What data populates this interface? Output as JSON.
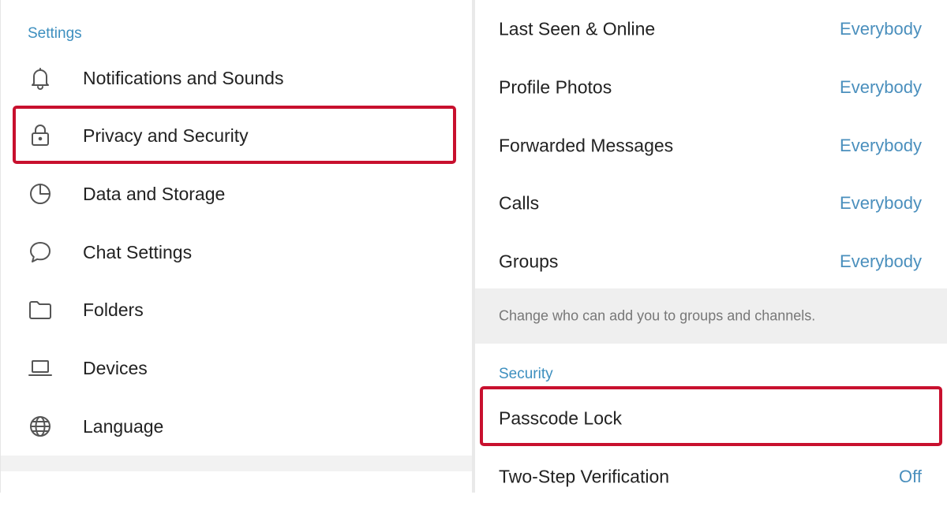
{
  "left_panel": {
    "header": "Settings",
    "items": [
      {
        "label": "Notifications and Sounds",
        "icon": "bell-icon"
      },
      {
        "label": "Privacy and Security",
        "icon": "lock-icon"
      },
      {
        "label": "Data and Storage",
        "icon": "pie-chart-icon"
      },
      {
        "label": "Chat Settings",
        "icon": "chat-bubble-icon"
      },
      {
        "label": "Folders",
        "icon": "folder-icon"
      },
      {
        "label": "Devices",
        "icon": "laptop-icon"
      },
      {
        "label": "Language",
        "icon": "globe-icon"
      }
    ]
  },
  "right_panel": {
    "privacy_rows": [
      {
        "label": "Last Seen & Online",
        "value": "Everybody"
      },
      {
        "label": "Profile Photos",
        "value": "Everybody"
      },
      {
        "label": "Forwarded Messages",
        "value": "Everybody"
      },
      {
        "label": "Calls",
        "value": "Everybody"
      },
      {
        "label": "Groups",
        "value": "Everybody"
      }
    ],
    "groups_hint": "Change who can add you to groups and channels.",
    "security_header": "Security",
    "security_rows": [
      {
        "label": "Passcode Lock",
        "value": ""
      },
      {
        "label": "Two-Step Verification",
        "value": "Off"
      }
    ]
  },
  "colors": {
    "accent": "#3d8fbf",
    "highlight": "#c8102e"
  }
}
